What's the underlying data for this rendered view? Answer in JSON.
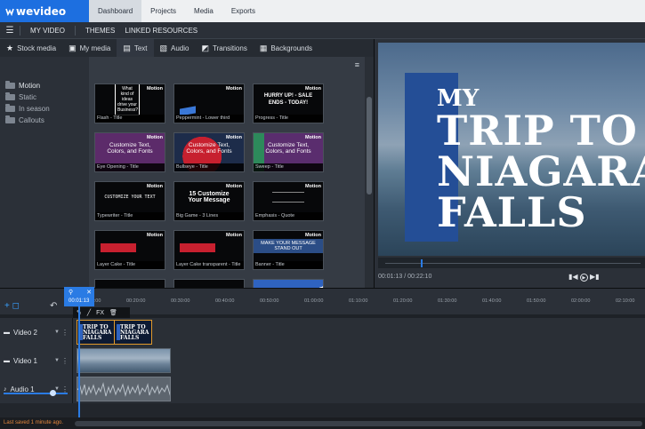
{
  "brand": {
    "name": "wevideo",
    "color": "#1d6fe0"
  },
  "topnav": {
    "tabs": [
      "Dashboard",
      "Projects",
      "Media",
      "Exports"
    ],
    "active": "Dashboard"
  },
  "secbar": {
    "project": "MY VIDEO",
    "themes": "THEMES",
    "linked": "LINKED RESOURCES"
  },
  "tabs": [
    {
      "label": "Stock media",
      "icon": "star-icon"
    },
    {
      "label": "My media",
      "icon": "film-icon"
    },
    {
      "label": "Text",
      "icon": "text-icon",
      "active": true
    },
    {
      "label": "Audio",
      "icon": "audio-icon"
    },
    {
      "label": "Transitions",
      "icon": "transitions-icon"
    },
    {
      "label": "Backgrounds",
      "icon": "backgrounds-icon"
    }
  ],
  "folders": [
    {
      "label": "Motion",
      "active": true
    },
    {
      "label": "Static"
    },
    {
      "label": "In season"
    },
    {
      "label": "Callouts"
    }
  ],
  "thumbs": [
    {
      "caption": "Flash - Title",
      "badge": "Motion",
      "text": "What kind of ideas drive your Business?"
    },
    {
      "caption": "Peppermint - Lower third",
      "badge": "Motion",
      "text": ""
    },
    {
      "caption": "Progress - Title",
      "badge": "Motion",
      "text": "HURRY UP! - SALE ENDS - TODAY!"
    },
    {
      "caption": "Eye Opening - Title",
      "badge": "Motion",
      "text": "Customize Text, Colors, and Fonts"
    },
    {
      "caption": "Bullseye - Title",
      "badge": "Motion",
      "text": "Customize Text, Colors, and Fonts"
    },
    {
      "caption": "Sweep - Title",
      "badge": "Motion",
      "text": "Customize Text, Colors, and Fonts"
    },
    {
      "caption": "Typewriter - Title",
      "badge": "Motion",
      "text": "CUSTOMIZE YOUR TEXT"
    },
    {
      "caption": "Big Game - 3 Lines",
      "badge": "Motion",
      "text": "15 Customize Your Message"
    },
    {
      "caption": "Emphasis - Quote",
      "badge": "Motion",
      "text": ""
    },
    {
      "caption": "Layer Cake - Title",
      "badge": "Motion",
      "text": ""
    },
    {
      "caption": "Layer Cake transparent - Title",
      "badge": "Motion",
      "text": ""
    },
    {
      "caption": "Banner - Title",
      "badge": "Motion",
      "text": "MAKE YOUR MESSAGE STAND OUT"
    }
  ],
  "preview": {
    "line1": "MY",
    "line2": "TRIP TO",
    "line3": "NIAGARA",
    "line4": "FALLS",
    "time": "00:01:13 / 00:22:10"
  },
  "timeline": {
    "playhead": "00:01:13",
    "ticks": [
      "00:10:00",
      "00:20:00",
      "00:30:00",
      "00:40:00",
      "00:50:00",
      "01:00:00",
      "01:10:00",
      "01:20:00",
      "01:30:00",
      "01:40:00",
      "01:50:00",
      "02:00:00",
      "02:10:00"
    ],
    "clip_tool_fx": "FX",
    "tracks": [
      {
        "label": "Video 2"
      },
      {
        "label": "Video 1"
      },
      {
        "label": "Audio 1"
      }
    ],
    "clip_title_text": "TRIP TO NIAGARA FALLS"
  },
  "status": {
    "text": "Last saved 1 minute ago."
  }
}
